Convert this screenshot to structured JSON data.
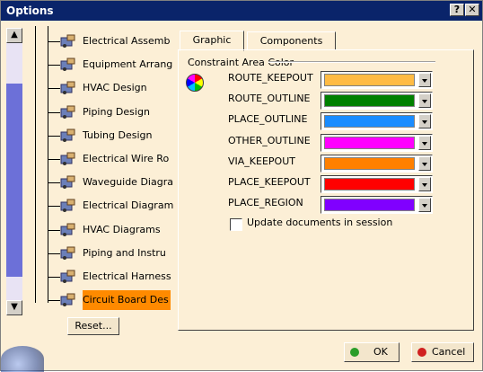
{
  "window": {
    "title": "Options",
    "help_btn": "?",
    "close_btn": "✕"
  },
  "tree": {
    "items": [
      {
        "label": "Electrical Assemb",
        "icon": "electrical-assembly-icon"
      },
      {
        "label": "Equipment Arrang",
        "icon": "equipment-arrangement-icon"
      },
      {
        "label": "HVAC Design",
        "icon": "hvac-design-icon"
      },
      {
        "label": "Piping Design",
        "icon": "piping-design-icon"
      },
      {
        "label": "Tubing Design",
        "icon": "tubing-design-icon"
      },
      {
        "label": "Electrical Wire Ro",
        "icon": "electrical-wire-routing-icon"
      },
      {
        "label": "Waveguide Diagra",
        "icon": "waveguide-diagram-icon"
      },
      {
        "label": "Electrical Diagram",
        "icon": "electrical-diagram-icon"
      },
      {
        "label": "HVAC Diagrams",
        "icon": "hvac-diagrams-icon"
      },
      {
        "label": "Piping and Instru",
        "icon": "piping-instrumentation-icon"
      },
      {
        "label": "Electrical Harness",
        "icon": "electrical-harness-icon"
      },
      {
        "label": "Circuit Board Des",
        "icon": "circuit-board-design-icon",
        "selected": true
      }
    ]
  },
  "reset_label": "Reset...",
  "tabs": [
    {
      "label": "Graphic",
      "active": true
    },
    {
      "label": "Components",
      "active": false
    }
  ],
  "group": {
    "title": "Constraint Area Color"
  },
  "constraints": [
    {
      "label": "ROUTE_KEEPOUT",
      "color": "#ffbb44"
    },
    {
      "label": "ROUTE_OUTLINE",
      "color": "#008000"
    },
    {
      "label": "PLACE_OUTLINE",
      "color": "#1a8cff"
    },
    {
      "label": "OTHER_OUTLINE",
      "color": "#ff00ff"
    },
    {
      "label": "VIA_KEEPOUT",
      "color": "#ff8000"
    },
    {
      "label": "PLACE_KEEPOUT",
      "color": "#ff0000"
    },
    {
      "label": "PLACE_REGION",
      "color": "#8000ff"
    }
  ],
  "update_docs": {
    "label": "Update documents in session",
    "checked": false
  },
  "ok_label": "OK",
  "cancel_label": "Cancel",
  "colors": {
    "ok_dot": "#2a9d2a",
    "cancel_dot": "#d02020",
    "title_bar": "#0a246a",
    "selection": "#ff8a00"
  }
}
